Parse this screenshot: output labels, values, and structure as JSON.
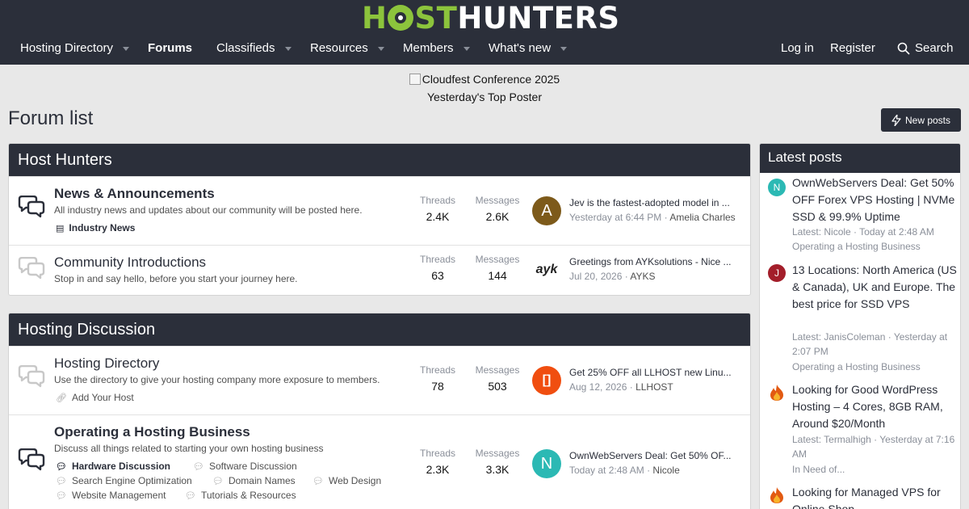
{
  "site": {
    "logo_part1": "H",
    "logo_part2": "ST",
    "logo_part3": "HUNTERS"
  },
  "nav": {
    "items": [
      "Hosting Directory",
      "Forums",
      "Classifieds",
      "Resources",
      "Members",
      "What's new"
    ],
    "login": "Log in",
    "register": "Register",
    "search": "Search"
  },
  "banner": {
    "image_alt": "Cloudfest Conference 2025",
    "top_poster": "Yesterday's Top Poster"
  },
  "page": {
    "title": "Forum list",
    "new_posts": "New posts"
  },
  "labels": {
    "threads": "Threads",
    "messages": "Messages"
  },
  "categories": [
    {
      "title": "Host Hunters",
      "forums": [
        {
          "title": "News & Announcements",
          "desc": "All industry news and updates about our community will be posted here.",
          "subforums": [
            "Industry News"
          ],
          "threads": "2.4K",
          "messages": "2.6K",
          "last_title": "Jev is the fastest-adopted model in ...",
          "last_date": "Yesterday at 6:44 PM",
          "last_user": "Amelia Charles",
          "avatar_letter": "A"
        },
        {
          "title": "Community Introductions",
          "desc": "Stop in and say hello, before you start your journey here.",
          "threads": "63",
          "messages": "144",
          "last_title": "Greetings from AYKsolutions - Nice ...",
          "last_date": "Jul 20, 2026",
          "last_user": "AYKS",
          "avatar_letter": "ayk"
        }
      ]
    },
    {
      "title": "Hosting Discussion",
      "forums": [
        {
          "title": "Hosting Directory",
          "desc": "Use the directory to give your hosting company more exposure to members.",
          "subforums": [
            "Add Your Host"
          ],
          "threads": "78",
          "messages": "503",
          "last_title": "Get 25% OFF all LLHOST new Linu...",
          "last_date": "Aug 12, 2026",
          "last_user": "LLHOST",
          "avatar_letter": "[]"
        },
        {
          "title": "Operating a Hosting Business",
          "desc": "Discuss all things related to starting your own hosting business",
          "subforums": [
            "Hardware Discussion",
            "Software Discussion",
            "Search Engine Optimization",
            "Domain Names",
            "Web Design",
            "Website Management",
            "Tutorials & Resources"
          ],
          "threads": "2.3K",
          "messages": "3.3K",
          "last_title": "OwnWebServers Deal: Get 50% OF...",
          "last_date": "Today at 2:48 AM",
          "last_user": "Nicole",
          "avatar_letter": "N"
        }
      ]
    }
  ],
  "sidebar": {
    "title": "Latest posts",
    "posts": [
      {
        "avatar": "N",
        "title": "OwnWebServers Deal: Get 50% OFF Forex VPS Hosting | NVMe SSD & 99.9% Uptime",
        "meta": "Latest: Nicole · Today at 2:48 AM",
        "forum": "Operating a Hosting Business"
      },
      {
        "avatar": "J",
        "title": "13 Locations: North America (US & Canada), UK and Europe. The best price for SSD VPS",
        "meta": "Latest: JanisColeman · Yesterday at 2:07 PM",
        "forum": "Operating a Hosting Business"
      },
      {
        "avatar": "",
        "title": "Looking for Good WordPress Hosting – 4 Cores, 8GB RAM, Around $20/Month",
        "meta": "Latest: Termalhigh · Yesterday at 7:16 AM",
        "forum": "In Need of..."
      },
      {
        "avatar": "",
        "title": "Looking for Managed VPS for Online Shop",
        "meta": "",
        "forum": ""
      }
    ]
  },
  "colors": {
    "header_bg": "#2b2f3a",
    "logo_green": "#8cc43c",
    "page_bg": "#e8e8e8",
    "avatar_amelia": "#7d5a1a",
    "avatar_llhost": "#f04e10",
    "avatar_nicole": "#2bb9b4",
    "avatar_janis": "#a31e2a"
  }
}
